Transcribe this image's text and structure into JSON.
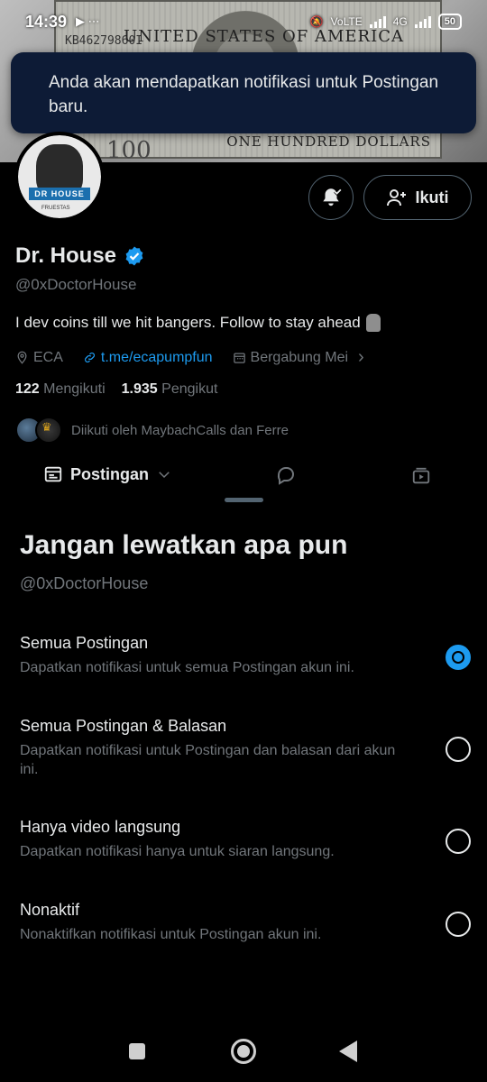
{
  "status_bar": {
    "time": "14:39",
    "network": "4G",
    "volte": "VoLTE",
    "battery": "50"
  },
  "banner": {
    "serial": "KB46279860I",
    "country": "UNITED STATES OF AMERICA",
    "denomination": "ONE HUNDRED DOLLARS",
    "number": "100"
  },
  "toast": {
    "message": "Anda akan mendapatkan notifikasi untuk Postingan baru."
  },
  "profile": {
    "avatar_label": "DR HOUSE",
    "avatar_sublabel": "FRUESTAS",
    "name": "Dr. House",
    "handle": "@0xDoctorHouse",
    "bio": "I dev coins till we hit bangers. Follow to stay ahead",
    "location": "ECA",
    "link": "t.me/ecapumpfun",
    "joined": "Bergabung Mei",
    "following_count": "122",
    "following_label": "Mengikuti",
    "followers_count": "1.935",
    "followers_label": "Pengikut",
    "followed_by": "Diikuti oleh MaybachCalls dan Ferre"
  },
  "actions": {
    "follow_label": "Ikuti"
  },
  "tabs": {
    "posts_label": "Postingan"
  },
  "sheet": {
    "title": "Jangan lewatkan apa pun",
    "handle": "@0xDoctorHouse",
    "options": [
      {
        "title": "Semua Postingan",
        "desc": "Dapatkan notifikasi untuk semua Postingan akun ini.",
        "selected": true
      },
      {
        "title": "Semua Postingan & Balasan",
        "desc": "Dapatkan notifikasi untuk Postingan dan balasan dari akun ini.",
        "selected": false
      },
      {
        "title": "Hanya video langsung",
        "desc": "Dapatkan notifikasi hanya untuk siaran langsung.",
        "selected": false
      },
      {
        "title": "Nonaktif",
        "desc": "Nonaktifkan notifikasi untuk Postingan akun ini.",
        "selected": false
      }
    ]
  },
  "colors": {
    "accent": "#1d9bf0",
    "toast_bg": "#0d1b36",
    "muted_text": "#71767b"
  }
}
